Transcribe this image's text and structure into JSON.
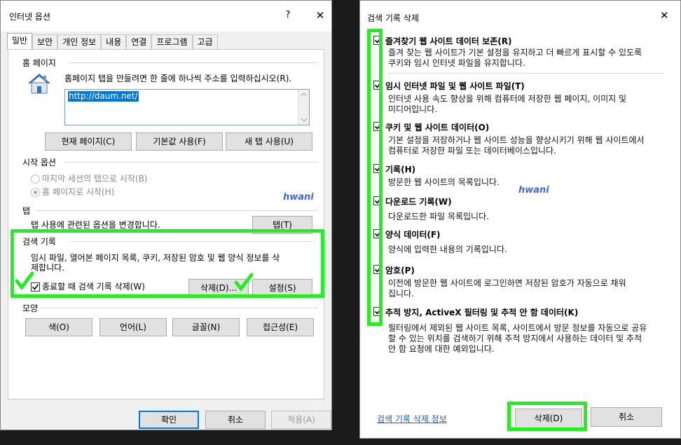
{
  "options_dialog": {
    "title": "인터넷 옵션",
    "help": "?",
    "close": "✕",
    "tabs": [
      "일반",
      "보안",
      "개인 정보",
      "내용",
      "연결",
      "프로그램",
      "고급"
    ],
    "home": {
      "heading": "홈 페이지",
      "instruction": "홈페이지 탭을 만들려면 한 줄에 하나씩 주소를 입력하십시오(R).",
      "url": "http://daum.net/",
      "buttons": [
        "현재 페이지(C)",
        "기본값 사용(F)",
        "새 탭 사용(U)"
      ]
    },
    "startup": {
      "heading": "시작 옵션",
      "option1": "마지막 세션의 탭으로 시작(B)",
      "option2": "홈 페이지로 시작(H)"
    },
    "watermark": "hwani",
    "tabs_section": {
      "heading": "탭",
      "text": "탭 사용에 관련된 옵션을 변경합니다.",
      "button": "탭(T)"
    },
    "history": {
      "heading": "검색 기록",
      "text1": "임시 파일, 열어본 페이지 목록, 쿠키, 저장된 암호 및 웹 양식 정보를 삭",
      "text2": "제합니다.",
      "checkbox": "종료할 때 검색 기록 삭제(W)",
      "delete_button": "삭제(D)...",
      "settings_button": "설정(S)"
    },
    "appearance": {
      "heading": "모양",
      "buttons": [
        "색(O)",
        "언어(L)",
        "글꼴(N)",
        "접근성(E)"
      ]
    },
    "footer": {
      "ok": "확인",
      "cancel": "취소",
      "apply": "적용(A)"
    }
  },
  "delete_dialog": {
    "title": "검색 기록 삭제",
    "close": "✕",
    "watermark": "hwani",
    "items": [
      {
        "title": "즐겨찾기 웹 사이트 데이터 보존(R)",
        "desc1": "즐겨 찾는 웹 사이트가 기본 설정을 유지하고 더 빠르게 표시할 수 있도록",
        "desc2": "쿠키와 임시 인터넷 파일을 유지합니다.",
        "desc3": ""
      },
      {
        "title": "임시 인터넷 파일 및 웹 사이트 파일(T)",
        "desc1": "인터넷 사용 속도 향상을 위해 컴퓨터에 저장한 웹 페이지, 이미지 및",
        "desc2": "미디어입니다.",
        "desc3": ""
      },
      {
        "title": "쿠키 및 웹 사이트 데이터(O)",
        "desc1": "기본 설정을 저장하거나 웹 사이트 성능을 향상시키기 위해 웹 사이트에서",
        "desc2": "컴퓨터로 저장한 파일 또는 데이터베이스입니다.",
        "desc3": ""
      },
      {
        "title": "기록(H)",
        "desc1": "방문한 웹 사이트의 목록입니다.",
        "desc2": "",
        "desc3": ""
      },
      {
        "title": "다운로드 기록(W)",
        "desc1": "다운로드한 파일 목록입니다.",
        "desc2": "",
        "desc3": ""
      },
      {
        "title": "양식 데이터(F)",
        "desc1": "양식에 입력한 내용의 기록입니다.",
        "desc2": "",
        "desc3": ""
      },
      {
        "title": "암호(P)",
        "desc1": "이전에 방문한 웹 사이트에 로그인하면 저장된 암호가 자동으로 채워",
        "desc2": "집니다.",
        "desc3": ""
      },
      {
        "title": "추적 방지, ActiveX 필터링 및 추적 안 함 데이터(K)",
        "desc1": "필터링에서 제외된 웹 사이트 목록, 사이트에서 방문 정보를 자동으로 공유",
        "desc2": "할 수 있는 위치를 검색하기 위해 추적 방지에서 사용하는 데이터 및 추적",
        "desc3": "안 함 요청에 대한 예외입니다."
      }
    ],
    "info_link": "검색 기록 삭제 정보",
    "delete_button": "삭제(D)",
    "cancel_button": "취소"
  },
  "colors": {
    "highlight": "#22ee22",
    "selection": "#0078d7",
    "watermark": "#4466cc"
  }
}
